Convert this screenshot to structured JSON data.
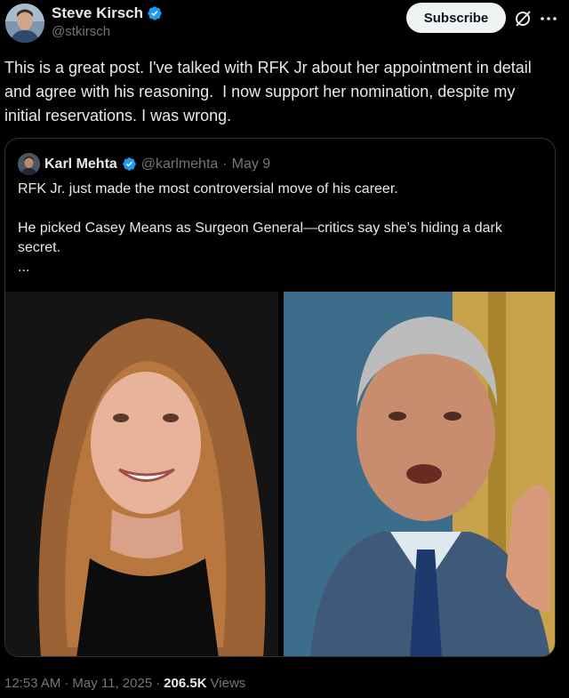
{
  "author": {
    "display_name": "Steve Kirsch",
    "handle": "@stkirsch"
  },
  "actions": {
    "subscribe_label": "Subscribe",
    "grok_icon": "grok-slash-icon",
    "more_icon": "more-horizontal-icon"
  },
  "post": {
    "text": "This is a great post. I've talked with RFK Jr about her appointment in detail and agree with his reasoning.  I now support her nomination, despite my initial reservations. I was wrong."
  },
  "quote": {
    "display_name": "Karl Mehta",
    "handle": "@karlmehta",
    "separator": "·",
    "date": "May 9",
    "line1": "RFK Jr. just made the most controversial move of his career.",
    "line2": "He picked Casey Means as Surgeon General—critics say she’s hiding a dark secret.",
    "line3": "...",
    "media": [
      "photo-woman-smiling",
      "photo-man-speaking"
    ]
  },
  "meta": {
    "time": "12:53 AM",
    "sep1": "·",
    "date": "May 11, 2025",
    "sep2": "·",
    "views_count": "206.5K",
    "views_label": "Views"
  },
  "colors": {
    "background": "#000000",
    "text": "#e7e9ea",
    "muted": "#71767b",
    "verified": "#1d9bf0",
    "border": "#2f3336"
  }
}
